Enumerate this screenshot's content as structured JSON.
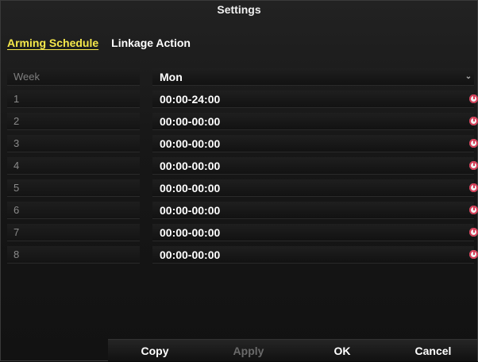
{
  "dialog": {
    "title": "Settings"
  },
  "tabs": [
    {
      "label": "Arming Schedule",
      "active": true
    },
    {
      "label": "Linkage Action",
      "active": false
    }
  ],
  "schedule": {
    "week_label": "Week",
    "day_value": "Mon",
    "periods": [
      {
        "index": "1",
        "time": "00:00-24:00"
      },
      {
        "index": "2",
        "time": "00:00-00:00"
      },
      {
        "index": "3",
        "time": "00:00-00:00"
      },
      {
        "index": "4",
        "time": "00:00-00:00"
      },
      {
        "index": "5",
        "time": "00:00-00:00"
      },
      {
        "index": "6",
        "time": "00:00-00:00"
      },
      {
        "index": "7",
        "time": "00:00-00:00"
      },
      {
        "index": "8",
        "time": "00:00-00:00"
      }
    ]
  },
  "footer": {
    "copy_label": "Copy",
    "apply_label": "Apply",
    "ok_label": "OK",
    "cancel_label": "Cancel"
  },
  "colors": {
    "active_tab": "#f5e84a",
    "clock_icon": "#d43b55"
  },
  "icons": {
    "period_edit": "clock-icon",
    "dropdown": "chevron-down-icon"
  }
}
